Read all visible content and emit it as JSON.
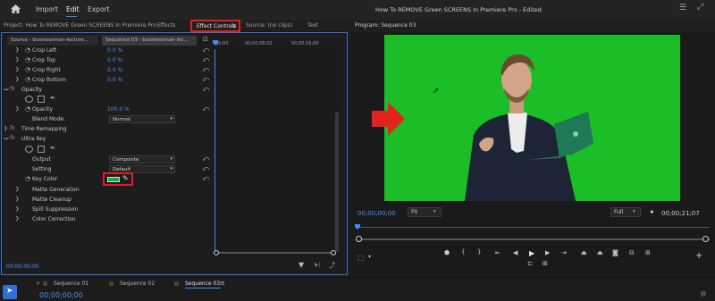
{
  "menu": {
    "home_icon": "home-icon",
    "items": [
      "Import",
      "Edit",
      "Export"
    ],
    "active": "Edit",
    "document_title": "How To REMOVE Green SCREENS In Premiere Pro - Edited"
  },
  "left_panel": {
    "project_tab": "Project: How To REMOVE Green SCREENS In Premiere Pro",
    "effects_tab": "Effects",
    "effect_controls_tab": "Effect Controls",
    "source_tab": "Source: (no clips)",
    "text_tab": "Text",
    "source_clip": "Source - businessman-lecture...",
    "sequence_clip": "Sequence 03 - businessman-lec...",
    "ruler": [
      "00;00",
      "00;00;08;00",
      "00;00;16;00"
    ],
    "timecode": "00;00;00;00"
  },
  "properties": [
    {
      "id": "crop-left",
      "name": "Crop Left",
      "value": "0.0 %"
    },
    {
      "id": "crop-top",
      "name": "Crop Top",
      "value": "0.0 %"
    },
    {
      "id": "crop-right",
      "name": "Crop Right",
      "value": "0.0 %"
    },
    {
      "id": "crop-bottom",
      "name": "Crop Bottom",
      "value": "0.0 %"
    },
    {
      "id": "opacity-header",
      "name": "Opacity"
    },
    {
      "id": "opacity",
      "name": "Opacity",
      "value": "100.0 %"
    },
    {
      "id": "blend-mode",
      "name": "Blend Mode",
      "value": "Normal"
    },
    {
      "id": "time-remapping",
      "name": "Time Remapping"
    },
    {
      "id": "ultra-key",
      "name": "Ultra Key"
    },
    {
      "id": "output",
      "name": "Output",
      "value": "Composite"
    },
    {
      "id": "setting",
      "name": "Setting",
      "value": "Default"
    },
    {
      "id": "key-color",
      "name": "Key Color",
      "swatch_color": "#1fa83a"
    },
    {
      "id": "matte-generation",
      "name": "Matte Generation"
    },
    {
      "id": "matte-cleanup",
      "name": "Matte Cleanup"
    },
    {
      "id": "spill-suppression",
      "name": "Spill Suppression"
    },
    {
      "id": "color-correction",
      "name": "Color Correction"
    }
  ],
  "program_monitor": {
    "title": "Program: Sequence 03",
    "timecode": "00;00;00;00",
    "fit": "Fit",
    "quality": "Full",
    "duration": "00;00;21;07",
    "green_color": "#1bbe26"
  },
  "timeline": {
    "tabs": [
      "Sequence 01",
      "Sequence 02",
      "Sequence 03"
    ],
    "active_tab": "Sequence 03",
    "timecode": "00;00;00;00"
  },
  "colors": {
    "accent_blue": "#3b6fd0",
    "highlight_red": "#e02020"
  }
}
